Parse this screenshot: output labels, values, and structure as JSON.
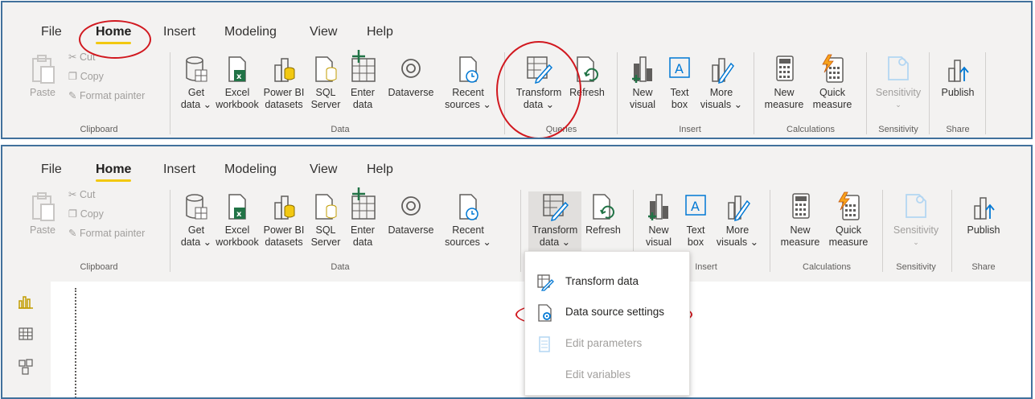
{
  "menu": [
    "File",
    "Home",
    "Insert",
    "Modeling",
    "View",
    "Help"
  ],
  "clipboard": {
    "paste": "Paste",
    "cut": "Cut",
    "copy": "Copy",
    "format_painter": "Format painter",
    "group": "Clipboard"
  },
  "data_group": {
    "get_data": [
      "Get",
      "data ⌄"
    ],
    "excel": [
      "Excel",
      "workbook"
    ],
    "powerbi": [
      "Power BI",
      "datasets"
    ],
    "sql": [
      "SQL",
      "Server"
    ],
    "enter": [
      "Enter",
      "data"
    ],
    "dataverse": [
      "Dataverse",
      ""
    ],
    "recent": [
      "Recent",
      "sources ⌄"
    ],
    "group": "Data"
  },
  "queries": {
    "transform": [
      "Transform",
      "data ⌄"
    ],
    "refresh": [
      "Refresh",
      ""
    ],
    "group": "Queries"
  },
  "insert": {
    "new_visual": [
      "New",
      "visual"
    ],
    "text_box": [
      "Text",
      "box"
    ],
    "more_visuals": [
      "More",
      "visuals ⌄"
    ],
    "group": "Insert"
  },
  "calculations": {
    "new_measure": [
      "New",
      "measure"
    ],
    "quick_measure": [
      "Quick",
      "measure"
    ],
    "group": "Calculations"
  },
  "sensitivity": {
    "label": "Sensitivity",
    "chev": "⌄",
    "group": "Sensitivity"
  },
  "share": {
    "publish": "Publish",
    "group": "Share"
  },
  "dropdown": {
    "items": [
      {
        "label": "Transform data",
        "enabled": true
      },
      {
        "label": "Data source settings",
        "enabled": true
      },
      {
        "label": "Edit parameters",
        "enabled": false
      },
      {
        "label": "Edit variables",
        "enabled": false
      }
    ]
  },
  "colors": {
    "accent": "#f2c811",
    "annotation": "#d1181f",
    "border": "#41719c",
    "excel": "#217346"
  }
}
